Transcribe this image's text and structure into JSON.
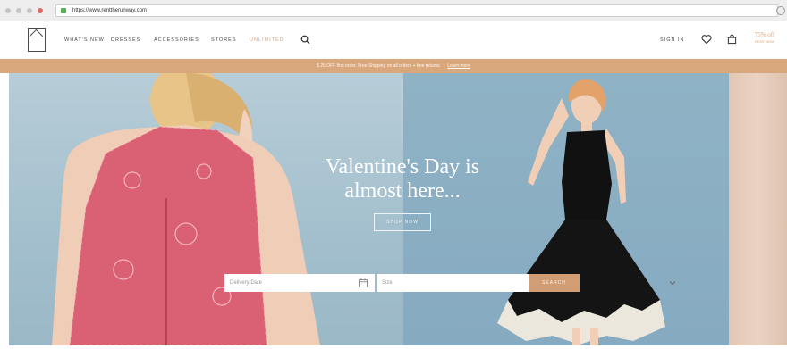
{
  "browser": {
    "url": "https://www.renttherunway.com"
  },
  "header": {
    "nav": [
      {
        "label": "WHAT'S NEW"
      },
      {
        "label": "DRESSES"
      },
      {
        "label": "ACCESSORIES"
      },
      {
        "label": "STORES"
      },
      {
        "label": "UNLIMITED"
      }
    ],
    "sign_in": "SIGN IN",
    "promo_logo_big": "75% off",
    "promo_logo_small": "RENT NOW"
  },
  "banner": {
    "text": "$ 25 OFF first order. Free Shipping on all orders + free returns.",
    "cta": "Learn more"
  },
  "hero": {
    "headline_line1": "Valentine's Day is",
    "headline_line2": "almost here...",
    "cta": "SHOP NOW"
  },
  "search": {
    "date_placeholder": "Delivery Date",
    "size_placeholder": "Size",
    "button": "SEARCH"
  },
  "colors": {
    "accent": "#d4a47c",
    "banner": "#d9a77c",
    "button": "#d29d73",
    "hero_blue": "#9fbac9"
  }
}
